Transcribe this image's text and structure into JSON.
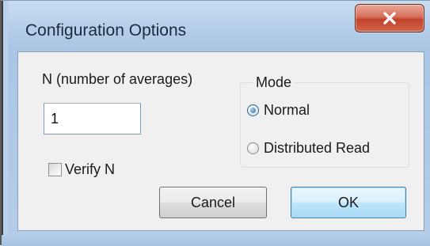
{
  "window": {
    "title": "Configuration Options",
    "close_icon": "close-x-icon"
  },
  "n_field": {
    "label": "N (number of averages)",
    "value": "1"
  },
  "verify": {
    "label": "Verify N",
    "checked": false
  },
  "mode": {
    "legend": "Mode",
    "options": [
      {
        "label": "Normal",
        "selected": true
      },
      {
        "label": "Distributed Read",
        "selected": false
      }
    ]
  },
  "buttons": {
    "cancel_label": "Cancel",
    "ok_label": "OK"
  },
  "colors": {
    "close_button": "#c7442b",
    "ok_button_border": "#3c7fb1",
    "client_background": "#f0f0f0",
    "frame": "#b9d1ea"
  }
}
